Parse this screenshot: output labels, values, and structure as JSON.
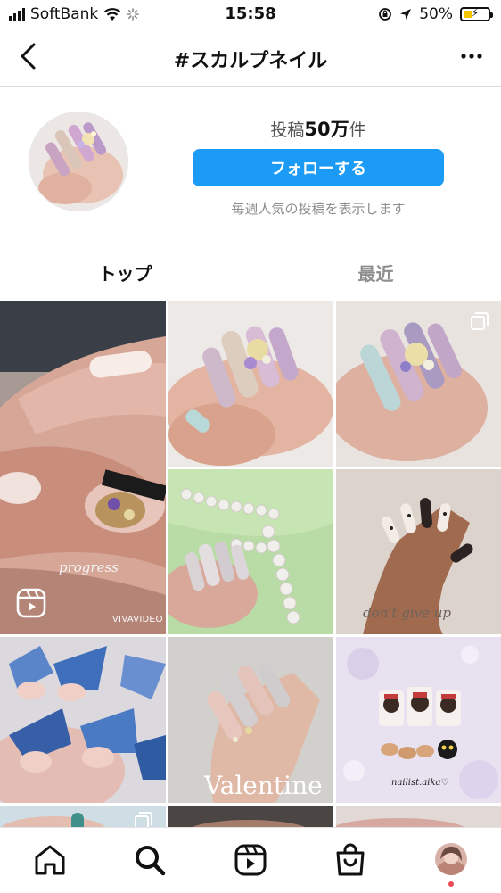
{
  "status_bar": {
    "carrier": "SoftBank",
    "time": "15:58",
    "battery": "50%"
  },
  "header": {
    "title": "#スカルプネイル"
  },
  "hashtag": {
    "posts_label_prefix": "投稿",
    "posts_count": "50万",
    "posts_label_suffix": "件",
    "follow_button": "フォローする",
    "weekly_note": "毎週人気の投稿を表示します"
  },
  "tabs": [
    {
      "label": "トップ",
      "active": true
    },
    {
      "label": "最近",
      "active": false
    }
  ],
  "grid": {
    "overlays": {
      "progress": "progress",
      "vivavideo": "VIVAVIDEO",
      "dont_give_up": "don't give up",
      "valentine": "Valentine",
      "nailist": "nailist.aika♡"
    }
  },
  "bottom_nav": {
    "items": [
      "home-icon",
      "search-icon",
      "reels-icon",
      "shop-icon",
      "profile-avatar"
    ]
  },
  "colors": {
    "follow_button": "#1c9bf6",
    "notification_dot": "#ed4956",
    "divider": "#dbdbdb"
  }
}
